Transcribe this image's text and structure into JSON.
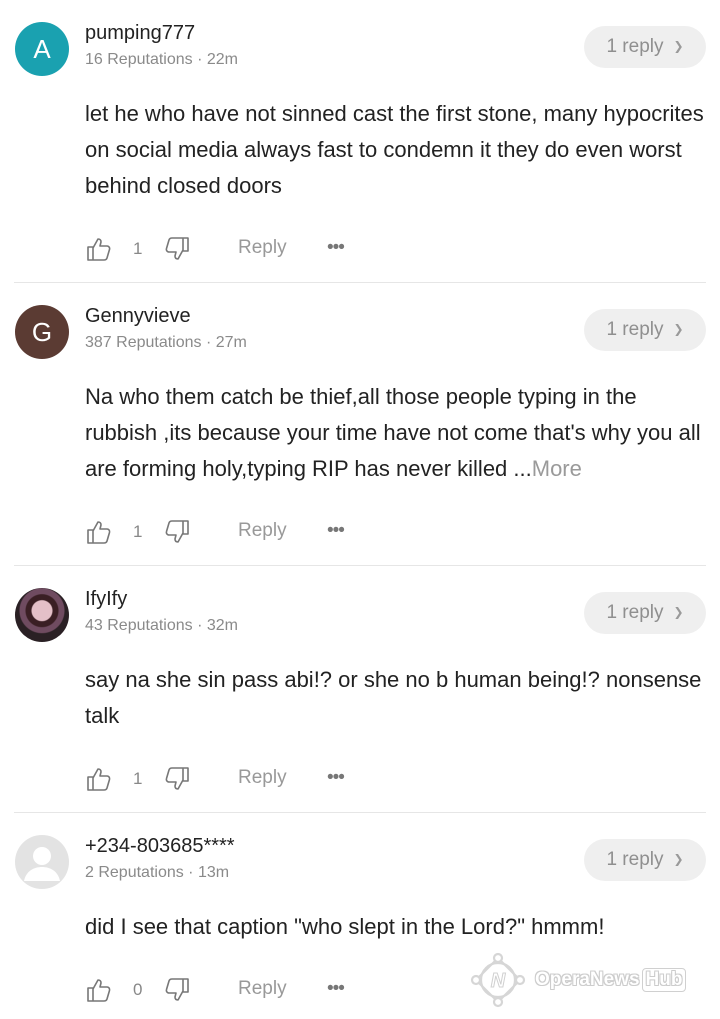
{
  "comments": [
    {
      "avatar_letter": "A",
      "avatar_color": "#1aa1b0",
      "username": "pumping777",
      "meta": "16 Reputations · 22m",
      "replies_label": "1 reply",
      "text": "let he who have not sinned cast the first stone, many hypocrites on social media always fast to condemn  it they do even worst behind closed doors",
      "more": "",
      "likes": "1",
      "reply_label": "Reply",
      "more_menu": "•••"
    },
    {
      "avatar_letter": "G",
      "avatar_color": "#5b3b33",
      "username": "Gennyvieve",
      "meta": "387 Reputations · 27m",
      "replies_label": "1 reply",
      "text": "Na who them catch be thief,all those people typing in the rubbish ,its because your time have not come that's why you all are forming holy,typing RIP has never killed ...",
      "more": "More",
      "likes": "1",
      "reply_label": "Reply",
      "more_menu": "•••"
    },
    {
      "avatar_letter": "",
      "avatar_color": "",
      "username": "IfyIfy",
      "meta": "43 Reputations · 32m",
      "replies_label": "1 reply",
      "text": "say na she sin pass abi!? or she no b human being!? nonsense talk",
      "more": "",
      "likes": "1",
      "reply_label": "Reply",
      "more_menu": "•••"
    },
    {
      "avatar_letter": "",
      "avatar_color": "#e3e3e3",
      "username": "+234-803685****",
      "meta": "2 Reputations · 13m",
      "replies_label": "1 reply",
      "text": "did I see that caption \"who slept in the Lord?\" hmmm!",
      "more": "",
      "likes": "0",
      "reply_label": "Reply",
      "more_menu": "•••"
    }
  ],
  "watermark": {
    "brand": "OperaNews",
    "hub": "Hub"
  }
}
